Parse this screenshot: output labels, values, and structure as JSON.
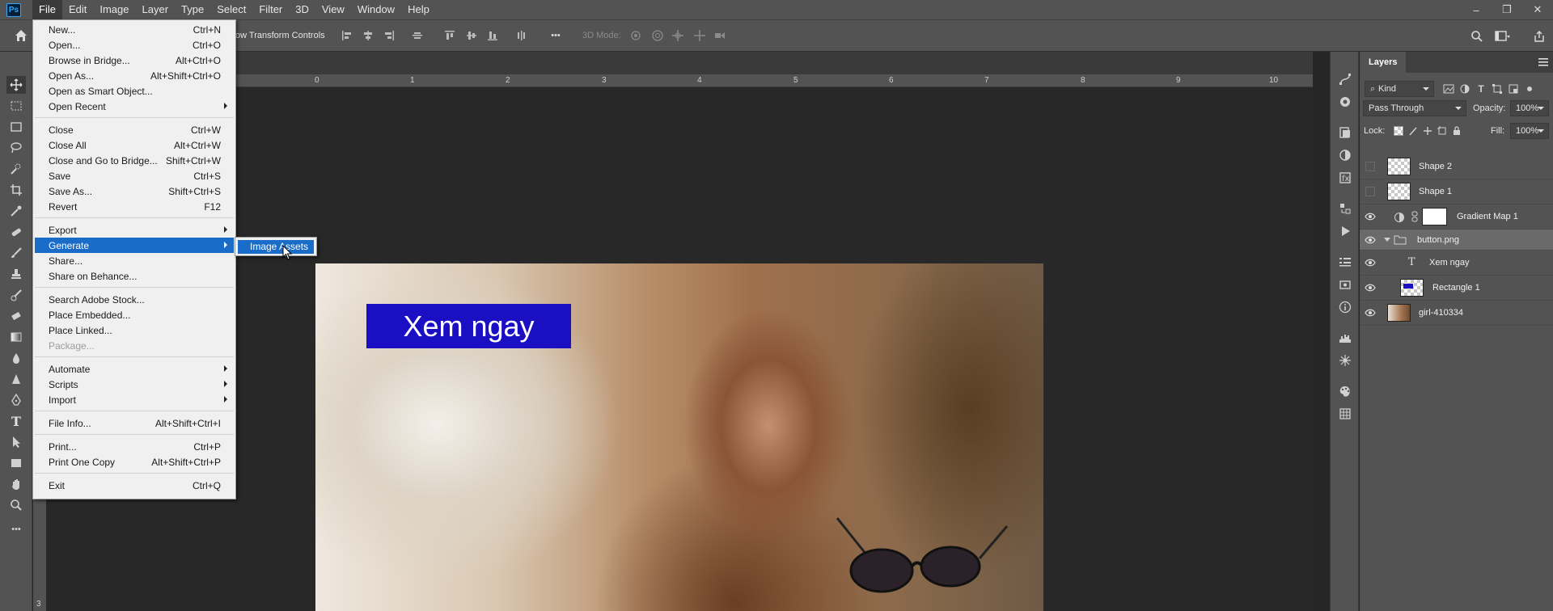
{
  "app": {
    "logo_text": "Ps",
    "menu": [
      "File",
      "Edit",
      "Image",
      "Layer",
      "Type",
      "Select",
      "Filter",
      "3D",
      "View",
      "Window",
      "Help"
    ],
    "active_menu": "File"
  },
  "window_controls": {
    "minimize": "–",
    "restore": "❐",
    "close": "✕"
  },
  "options_bar": {
    "transform_label": "ow Transform Controls",
    "mode_3d_label": "3D Mode:",
    "more_label": "•••"
  },
  "file_menu": {
    "items": [
      {
        "label": "New...",
        "shortcut": "Ctrl+N"
      },
      {
        "label": "Open...",
        "shortcut": "Ctrl+O"
      },
      {
        "label": "Browse in Bridge...",
        "shortcut": "Alt+Ctrl+O"
      },
      {
        "label": "Open As...",
        "shortcut": "Alt+Shift+Ctrl+O"
      },
      {
        "label": "Open as Smart Object...",
        "shortcut": ""
      },
      {
        "label": "Open Recent",
        "shortcut": ""
      },
      {
        "label": "Close",
        "shortcut": "Ctrl+W"
      },
      {
        "label": "Close All",
        "shortcut": "Alt+Ctrl+W"
      },
      {
        "label": "Close and Go to Bridge...",
        "shortcut": "Shift+Ctrl+W"
      },
      {
        "label": "Save",
        "shortcut": "Ctrl+S"
      },
      {
        "label": "Save As...",
        "shortcut": "Shift+Ctrl+S"
      },
      {
        "label": "Revert",
        "shortcut": "F12"
      },
      {
        "label": "Export",
        "shortcut": ""
      },
      {
        "label": "Generate",
        "shortcut": ""
      },
      {
        "label": "Share...",
        "shortcut": ""
      },
      {
        "label": "Share on Behance...",
        "shortcut": ""
      },
      {
        "label": "Search Adobe Stock...",
        "shortcut": ""
      },
      {
        "label": "Place Embedded...",
        "shortcut": ""
      },
      {
        "label": "Place Linked...",
        "shortcut": ""
      },
      {
        "label": "Package...",
        "shortcut": ""
      },
      {
        "label": "Automate",
        "shortcut": ""
      },
      {
        "label": "Scripts",
        "shortcut": ""
      },
      {
        "label": "Import",
        "shortcut": ""
      },
      {
        "label": "File Info...",
        "shortcut": "Alt+Shift+Ctrl+I"
      },
      {
        "label": "Print...",
        "shortcut": "Ctrl+P"
      },
      {
        "label": "Print One Copy",
        "shortcut": "Alt+Shift+Ctrl+P"
      },
      {
        "label": "Exit",
        "shortcut": "Ctrl+Q"
      }
    ],
    "highlighted": "Generate",
    "disabled": [
      "Package..."
    ],
    "submenu_parents": [
      "Open Recent",
      "Export",
      "Generate",
      "Automate",
      "Scripts",
      "Import"
    ]
  },
  "generate_submenu": {
    "items": [
      "Image Assets"
    ],
    "highlighted": "Image Assets"
  },
  "ruler": {
    "top_numbers": [
      "0",
      "1",
      "2",
      "3",
      "4",
      "5",
      "6",
      "7",
      "8",
      "9",
      "10"
    ],
    "left_number": "3"
  },
  "canvas": {
    "button_text": "Xem ngay",
    "button_color": "#1a0fc2"
  },
  "layers_panel": {
    "tab": "Layers",
    "filter_kind": "Kind",
    "blend_mode": "Pass Through",
    "opacity_label": "Opacity:",
    "opacity_value": "100%",
    "lock_label": "Lock:",
    "fill_label": "Fill:",
    "fill_value": "100%",
    "layers": [
      {
        "name": "Shape 2",
        "visible": false,
        "kind": "shape"
      },
      {
        "name": "Shape 1",
        "visible": false,
        "kind": "shape"
      },
      {
        "name": "Gradient Map 1",
        "visible": true,
        "kind": "adjustment"
      },
      {
        "name": "button.png",
        "visible": true,
        "kind": "group",
        "selected": true
      },
      {
        "name": "Xem ngay",
        "visible": true,
        "kind": "text"
      },
      {
        "name": "Rectangle 1",
        "visible": true,
        "kind": "shape-rect"
      },
      {
        "name": "girl-410334",
        "visible": true,
        "kind": "image"
      }
    ]
  },
  "colors": {
    "accent": "#1a6cc9",
    "panel_bg": "#535353",
    "canvas_bg": "#282828"
  }
}
